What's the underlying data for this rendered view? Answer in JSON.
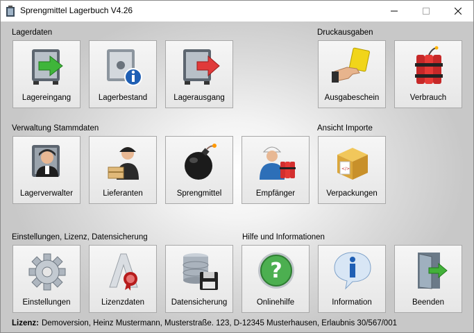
{
  "window": {
    "title": "Sprengmittel Lagerbuch V4.26"
  },
  "groups": {
    "lagerdaten": "Lagerdaten",
    "druckausgaben": "Druckausgaben",
    "stammdaten": "Verwaltung Stammdaten",
    "importe": "Ansicht Importe",
    "einstellungen": "Einstellungen, Lizenz, Datensicherung",
    "hilfe": "Hilfe und Informationen"
  },
  "tiles": {
    "lagereingang": "Lagereingang",
    "lagerbestand": "Lagerbestand",
    "lagerausgang": "Lagerausgang",
    "ausgabeschein": "Ausgabeschein",
    "verbrauch": "Verbrauch",
    "lagerverwalter": "Lagerverwalter",
    "lieferanten": "Lieferanten",
    "sprengmittel": "Sprengmittel",
    "empfaenger": "Empfänger",
    "verpackungen": "Verpackungen",
    "einstellungen": "Einstellungen",
    "lizenzdaten": "Lizenzdaten",
    "datensicherung": "Datensicherung",
    "onlinehilfe": "Onlinehilfe",
    "information": "Information",
    "beenden": "Beenden"
  },
  "status": {
    "label": "Lizenz:",
    "text": "Demoversion, Heinz Mustermann, Musterstraße. 123, D-12345 Musterhausen, Erlaubnis 30/567/001"
  },
  "icons": [
    "app-icon",
    "minimize-icon",
    "maximize-icon",
    "close-icon",
    "safe-in-icon",
    "safe-info-icon",
    "safe-out-icon",
    "hand-card-icon",
    "dynamite-icon",
    "safe-manager-icon",
    "delivery-person-icon",
    "bomb-icon",
    "worker-dynamite-icon",
    "box-icon",
    "gear-icon",
    "license-seal-icon",
    "database-floppy-icon",
    "help-icon",
    "info-icon",
    "exit-door-icon"
  ]
}
